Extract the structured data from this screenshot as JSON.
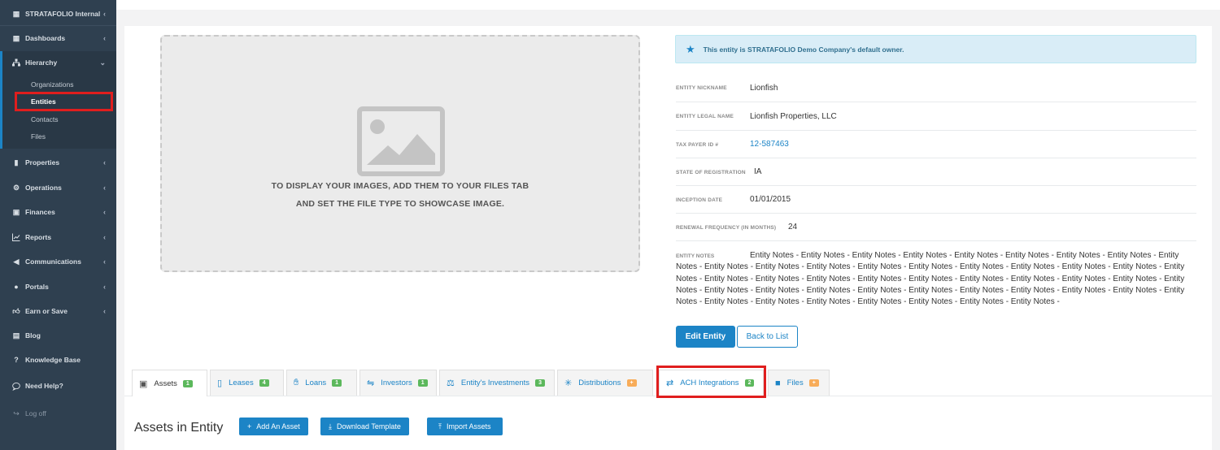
{
  "sidebar": {
    "org_switch": "STRATAFOLIO Internal",
    "items": [
      {
        "label": "Dashboards"
      },
      {
        "label": "Hierarchy"
      },
      {
        "label": "Properties"
      },
      {
        "label": "Operations"
      },
      {
        "label": "Finances"
      },
      {
        "label": "Reports"
      },
      {
        "label": "Communications"
      },
      {
        "label": "Portals"
      },
      {
        "label": "Earn or Save"
      },
      {
        "label": "Blog"
      },
      {
        "label": "Knowledge Base"
      },
      {
        "label": "Need Help?"
      },
      {
        "label": "Log off"
      }
    ],
    "hierarchy_sub": [
      "Organizations",
      "Entities",
      "Contacts",
      "Files"
    ]
  },
  "showcase": {
    "line1": "TO DISPLAY YOUR IMAGES, ADD THEM TO YOUR FILES TAB",
    "line2": "AND SET THE FILE TYPE TO SHOWCASE IMAGE."
  },
  "alert": "This entity is STRATAFOLIO Demo Company's default owner.",
  "fields": [
    {
      "label": "ENTITY NICKNAME",
      "value": "Lionfish"
    },
    {
      "label": "ENTITY LEGAL NAME",
      "value": "Lionfish Properties, LLC"
    },
    {
      "label": "TAX PAYER ID #",
      "value": "12-587463"
    },
    {
      "label": "STATE OF REGISTRATION",
      "value": "IA"
    },
    {
      "label": "INCEPTION DATE",
      "value": "01/01/2015"
    },
    {
      "label": "RENEWAL FREQUENCY (IN MONTHS)",
      "value": "24"
    }
  ],
  "notes": {
    "label": "ENTITY NOTES",
    "value": "Entity Notes - Entity Notes - Entity Notes - Entity Notes - Entity Notes - Entity Notes - Entity Notes - Entity Notes - Entity Notes - Entity Notes - Entity Notes - Entity Notes - Entity Notes - Entity Notes - Entity Notes - Entity Notes - Entity Notes - Entity Notes - Entity Notes - Entity Notes - Entity Notes - Entity Notes - Entity Notes - Entity Notes - Entity Notes - Entity Notes - Entity Notes - Entity Notes - Entity Notes - Entity Notes - Entity Notes - Entity Notes - Entity Notes - Entity Notes - Entity Notes - Entity Notes - Entity Notes - Entity Notes - Entity Notes - Entity Notes - Entity Notes - Entity Notes - Entity Notes - Entity Notes - Entity Notes - Entity Notes -"
  },
  "buttons": {
    "edit": "Edit Entity",
    "back": "Back to List"
  },
  "tabs": [
    {
      "label": "Assets",
      "badge": "1"
    },
    {
      "label": "Leases",
      "badge": "4"
    },
    {
      "label": "Loans",
      "badge": "1"
    },
    {
      "label": "Investors",
      "badge": "1"
    },
    {
      "label": "Entity's Investments",
      "badge": "3"
    },
    {
      "label": "Distributions",
      "badge": "+"
    },
    {
      "label": "ACH Integrations",
      "badge": "2"
    },
    {
      "label": "Files",
      "badge": "+"
    }
  ],
  "section": {
    "title": "Assets in Entity",
    "add": "Add An Asset",
    "download": "Download Template",
    "import": "Import Assets"
  },
  "colors": {
    "sidebar": "#2f4050",
    "accent": "#1c84c6",
    "highlight": "#e01e1e",
    "badge_green": "#5cb85c",
    "badge_orange": "#f8ac59"
  }
}
